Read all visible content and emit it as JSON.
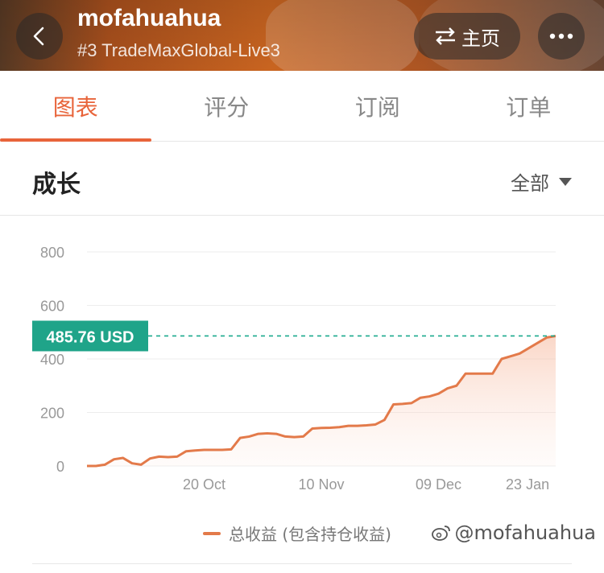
{
  "header": {
    "title": "mofahuahua",
    "subtitle": "#3 TradeMaxGlobal-Live3",
    "switch_label": "主页"
  },
  "tabs": [
    {
      "label": "图表",
      "active": true
    },
    {
      "label": "评分",
      "active": false
    },
    {
      "label": "订阅",
      "active": false
    },
    {
      "label": "订单",
      "active": false
    }
  ],
  "section": {
    "title": "成长",
    "filter_label": "全部"
  },
  "chart_data": {
    "type": "area",
    "ylim": [
      0,
      800
    ],
    "yticks": [
      "800",
      "600",
      "400",
      "200",
      "0"
    ],
    "xtick_labels": [
      "20 Oct",
      "10 Nov",
      "09 Dec",
      "23 Jan"
    ],
    "current_value_label": "485.76 USD",
    "series": [
      {
        "name": "总收益 (包含持仓收益)",
        "color": "#e37a4a",
        "values": [
          0,
          0,
          5,
          25,
          30,
          10,
          5,
          28,
          35,
          33,
          35,
          55,
          58,
          60,
          60,
          60,
          62,
          105,
          110,
          120,
          122,
          120,
          110,
          108,
          110,
          140,
          142,
          143,
          145,
          150,
          150,
          152,
          155,
          172,
          230,
          232,
          235,
          255,
          260,
          270,
          290,
          300,
          345,
          345,
          345,
          345,
          400,
          410,
          420,
          440,
          460,
          480,
          485.76
        ]
      }
    ]
  },
  "legend_label": "总收益 (包含持仓收益)",
  "watermark": "@mofahuahua"
}
